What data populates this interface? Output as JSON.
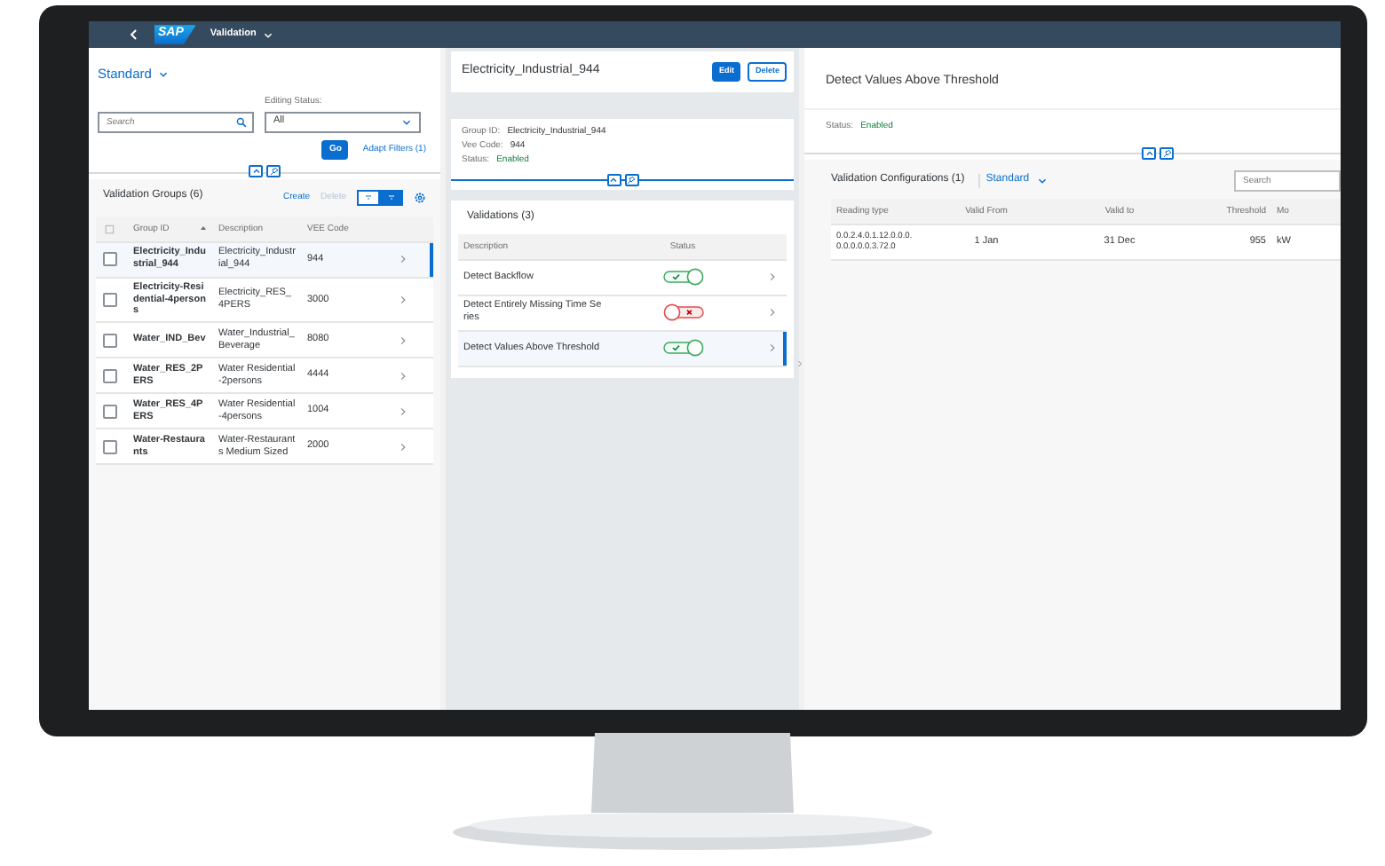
{
  "shell": {
    "logo": "SAP",
    "title": "Validation"
  },
  "filter_bar": {
    "variant": "Standard",
    "search": {
      "placeholder": "Search"
    },
    "editing_status": {
      "label": "Editing Status:",
      "value": "All"
    },
    "go": "Go",
    "adapt_filters": "Adapt Filters (1)"
  },
  "groups": {
    "title": "Validation Groups (6)",
    "actions": [
      {
        "label": "Create",
        "disabled": false
      },
      {
        "label": "Delete",
        "disabled": true
      }
    ],
    "view_toggle": [
      {
        "selected": false
      },
      {
        "selected": true
      }
    ],
    "columns": [
      "Group ID",
      "Description",
      "VEE Code"
    ],
    "rows": [
      {
        "group_id": "Electricity_Industrial_944",
        "description": "Electricity_Industrial_944",
        "vee_code": "944",
        "checked": false,
        "selected": true
      },
      {
        "group_id": "Electricity-Residential-4persons",
        "description": "Electricity_RES_4PERS",
        "vee_code": "3000",
        "checked": false,
        "selected": false
      },
      {
        "group_id": "Water_IND_Bev",
        "description": "Water_Industrial_Beverage",
        "vee_code": "8080",
        "checked": false,
        "selected": false
      },
      {
        "group_id": "Water_RES_2PERS",
        "description": "Water Residential-2persons",
        "vee_code": "4444",
        "checked": false,
        "selected": false
      },
      {
        "group_id": "Water_RES_4PERS",
        "description": "Water Residential-4persons",
        "vee_code": "1004",
        "checked": false,
        "selected": false
      },
      {
        "group_id": "Water-Restaurants",
        "description": "Water-Restaurants Medium Sized",
        "vee_code": "2000",
        "checked": false,
        "selected": false
      }
    ]
  },
  "detail": {
    "title": "Electricity_Industrial_944",
    "buttons": [
      {
        "label": "Edit",
        "kind": "primary"
      },
      {
        "label": "Delete",
        "kind": "default"
      }
    ],
    "fields": [
      {
        "label": "Group ID:",
        "value": "Electricity_Industrial_944",
        "kind": "text"
      },
      {
        "label": "Vee Code:",
        "value": "944",
        "kind": "text"
      },
      {
        "label": "Status:",
        "value": "Enabled",
        "kind": "positive"
      }
    ],
    "validations": {
      "title": "Validations (3)",
      "columns": [
        "Description",
        "Status"
      ],
      "rows": [
        {
          "description": "Detect Backflow",
          "on": true,
          "selected": false
        },
        {
          "description": "Detect Entirely Missing Time Series",
          "on": false,
          "selected": false
        },
        {
          "description": "Detect Values Above Threshold",
          "on": true,
          "selected": true
        }
      ]
    }
  },
  "object": {
    "title": "Detect Values Above Threshold",
    "status_label": "Status:",
    "status": "Enabled",
    "configurations": {
      "title": "Validation Configurations (1)",
      "variant": "Standard",
      "search": {
        "placeholder": "Search"
      },
      "columns": [
        "Reading type",
        "Valid From",
        "Valid to",
        "Threshold",
        "Mo"
      ],
      "rows": [
        {
          "cells": [
            "0.0.2.4.0.1.12.0.0.0.0.0.0.0.0.3.72.0",
            "1 Jan",
            "31 Dec",
            "955",
            "kW"
          ]
        }
      ]
    }
  }
}
